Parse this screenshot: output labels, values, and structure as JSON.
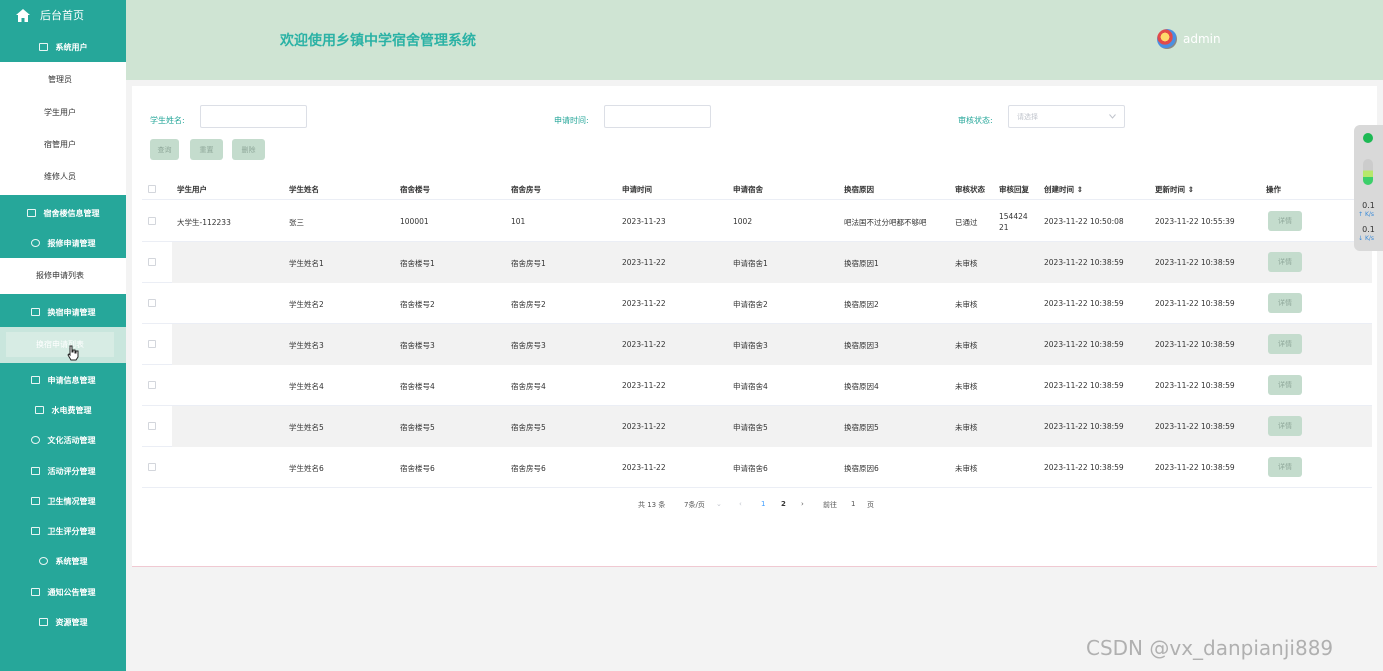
{
  "sidebar": {
    "home": "后台首页",
    "sections": [
      {
        "label": "系统用户",
        "icon": "square-icon"
      },
      {
        "label": "宿舍楼信息管理",
        "icon": "square-icon"
      },
      {
        "label": "报修申请管理",
        "icon": "globe-icon"
      },
      {
        "label": "换宿申请管理",
        "icon": "edit-icon"
      },
      {
        "label": "申请信息管理",
        "icon": "square-icon"
      },
      {
        "label": "水电费管理",
        "icon": "edit-icon"
      },
      {
        "label": "文化活动管理",
        "icon": "globe-icon"
      },
      {
        "label": "活动评分管理",
        "icon": "square-icon"
      },
      {
        "label": "卫生情况管理",
        "icon": "square-icon"
      },
      {
        "label": "卫生评分管理",
        "icon": "edit-icon"
      },
      {
        "label": "系统管理",
        "icon": "globe-icon"
      },
      {
        "label": "通知公告管理",
        "icon": "edit-icon"
      },
      {
        "label": "资源管理",
        "icon": "square-icon"
      }
    ],
    "user_items": [
      "管理员",
      "学生用户",
      "宿管用户",
      "维修人员"
    ],
    "repair_items": [
      "报修申请列表"
    ],
    "change_items": [
      "换宿申请列表"
    ]
  },
  "header": {
    "title": "欢迎使用乡镇中学宿舍管理系统",
    "user": "admin"
  },
  "filters": {
    "student_name_label": "学生姓名:",
    "apply_time_label": "申请时间:",
    "status_label": "审核状态:",
    "status_placeholder": "请选择"
  },
  "buttons": {
    "query": "查询",
    "reset": "重置",
    "delete": "删除",
    "detail": "详情"
  },
  "table": {
    "columns": [
      "学生用户",
      "学生姓名",
      "宿舍楼号",
      "宿舍房号",
      "申请时间",
      "申请宿舍",
      "换宿原因",
      "审核状态",
      "审核回复",
      "创建时间",
      "更新时间",
      "操作"
    ],
    "rows": [
      {
        "user": "大学生-112233",
        "name": "张三",
        "building": "100001",
        "room": "101",
        "apply_time": "2023-11-23",
        "apply_dorm": "1002",
        "reason": "吧法国不过分吧都不够吧",
        "status": "已通过",
        "reply": "154424 21",
        "created": "2023-11-22 10:50:08",
        "updated": "2023-11-22 10:55:39"
      },
      {
        "user": "",
        "name": "学生姓名1",
        "building": "宿舍楼号1",
        "room": "宿舍房号1",
        "apply_time": "2023-11-22",
        "apply_dorm": "申请宿舍1",
        "reason": "换宿原因1",
        "status": "未审核",
        "reply": "",
        "created": "2023-11-22 10:38:59",
        "updated": "2023-11-22 10:38:59"
      },
      {
        "user": "",
        "name": "学生姓名2",
        "building": "宿舍楼号2",
        "room": "宿舍房号2",
        "apply_time": "2023-11-22",
        "apply_dorm": "申请宿舍2",
        "reason": "换宿原因2",
        "status": "未审核",
        "reply": "",
        "created": "2023-11-22 10:38:59",
        "updated": "2023-11-22 10:38:59"
      },
      {
        "user": "",
        "name": "学生姓名3",
        "building": "宿舍楼号3",
        "room": "宿舍房号3",
        "apply_time": "2023-11-22",
        "apply_dorm": "申请宿舍3",
        "reason": "换宿原因3",
        "status": "未审核",
        "reply": "",
        "created": "2023-11-22 10:38:59",
        "updated": "2023-11-22 10:38:59"
      },
      {
        "user": "",
        "name": "学生姓名4",
        "building": "宿舍楼号4",
        "room": "宿舍房号4",
        "apply_time": "2023-11-22",
        "apply_dorm": "申请宿舍4",
        "reason": "换宿原因4",
        "status": "未审核",
        "reply": "",
        "created": "2023-11-22 10:38:59",
        "updated": "2023-11-22 10:38:59"
      },
      {
        "user": "",
        "name": "学生姓名5",
        "building": "宿舍楼号5",
        "room": "宿舍房号5",
        "apply_time": "2023-11-22",
        "apply_dorm": "申请宿舍5",
        "reason": "换宿原因5",
        "status": "未审核",
        "reply": "",
        "created": "2023-11-22 10:38:59",
        "updated": "2023-11-22 10:38:59"
      },
      {
        "user": "",
        "name": "学生姓名6",
        "building": "宿舍楼号6",
        "room": "宿舍房号6",
        "apply_time": "2023-11-22",
        "apply_dorm": "申请宿舍6",
        "reason": "换宿原因6",
        "status": "未审核",
        "reply": "",
        "created": "2023-11-22 10:38:59",
        "updated": "2023-11-22 10:38:59"
      }
    ]
  },
  "pagination": {
    "total": "共 13 条",
    "page_size": "7条/页",
    "page1": "1",
    "page2": "2",
    "goto_label": "前往",
    "goto_value": "1",
    "goto_suffix": "页"
  },
  "widget": {
    "up_value": "0.1",
    "up_unit": "K/s",
    "down_value": "0.1",
    "down_unit": "K/s"
  },
  "watermark": "CSDN @vx_danpianji889",
  "colors": {
    "sidebar": "#26a79a",
    "header": "#cfe4d3",
    "title": "#2bb2a5",
    "button": "#c4dccd"
  }
}
